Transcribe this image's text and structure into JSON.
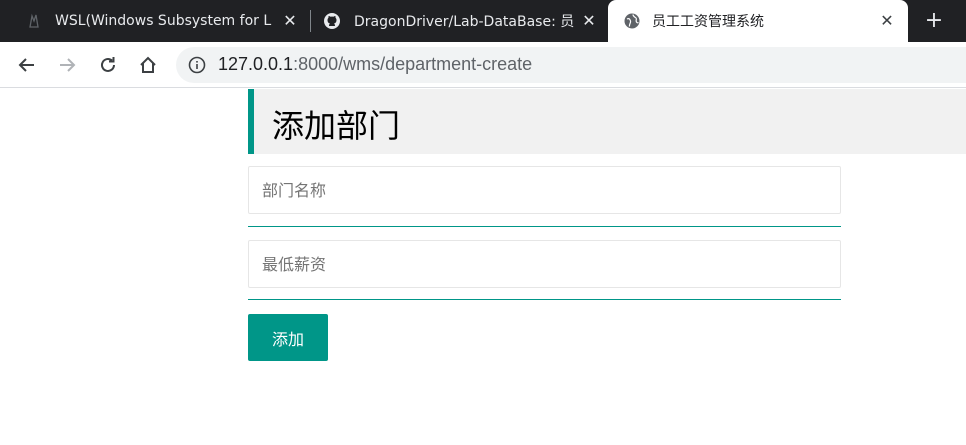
{
  "browser": {
    "tabs": [
      {
        "title": "WSL(Windows Subsystem for L",
        "icon": "wsl-tux-icon",
        "active": false
      },
      {
        "title": "DragonDriver/Lab-DataBase: 员",
        "icon": "github-icon",
        "active": false
      },
      {
        "title": "员工工资管理系统",
        "icon": "globe-icon",
        "active": true
      }
    ],
    "tab_close_glyph": "✕",
    "new_tab_glyph": "+",
    "url_host": "127.0.0.1",
    "url_rest": ":8000/wms/department-create"
  },
  "page": {
    "title": "添加部门",
    "fields": [
      {
        "placeholder": "部门名称",
        "value": ""
      },
      {
        "placeholder": "最低薪资",
        "value": ""
      }
    ],
    "submit_label": "添加"
  },
  "colors": {
    "accent": "#009688",
    "tabstrip": "#202124",
    "heading_bg": "#f1f1f1"
  }
}
